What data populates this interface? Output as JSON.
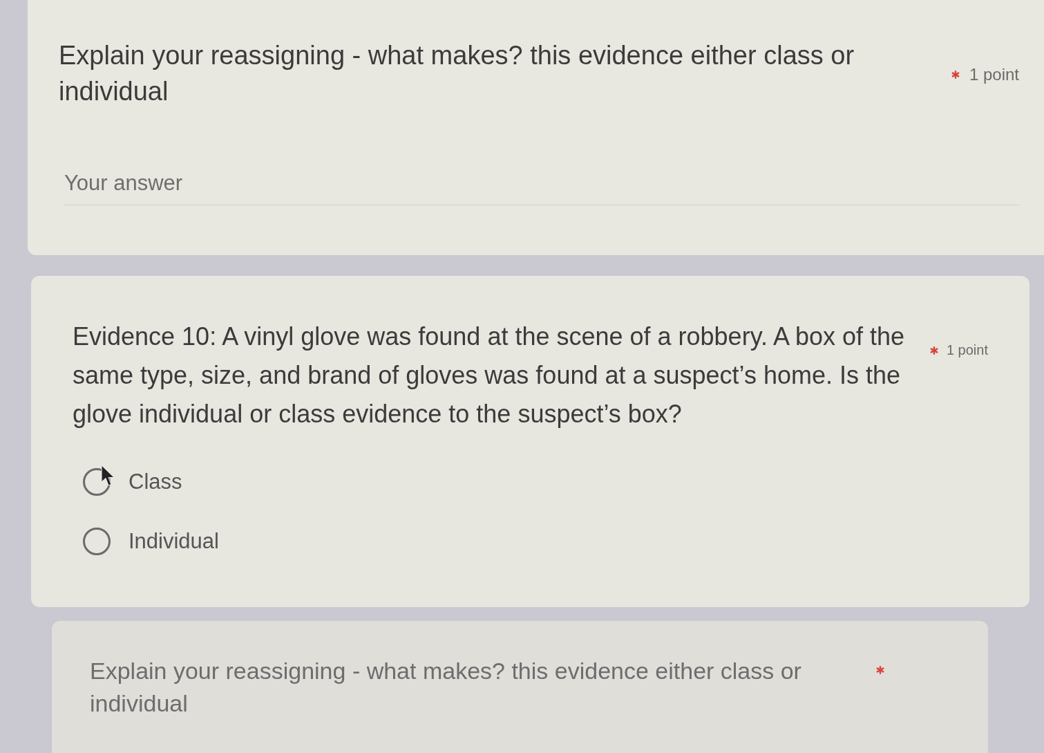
{
  "questions": [
    {
      "kind": "text",
      "title": "Explain your reassigning - what makes? this evidence either class or individual",
      "required": true,
      "points": "1 point",
      "answer": {
        "placeholder": "Your answer"
      }
    },
    {
      "kind": "choice",
      "title": "Evidence 10: A vinyl glove was found at the scene of a robbery. A box of the same type, size, and brand of gloves was found at a suspect’s home. Is the glove individual or class evidence to the suspect’s box?",
      "required": true,
      "points": "1 point",
      "options": [
        {
          "label": "Class",
          "selected": false
        },
        {
          "label": "Individual",
          "selected": false
        }
      ]
    },
    {
      "kind": "text",
      "title": "Explain your reassigning - what makes? this evidence either class or individual",
      "required": true
    }
  ]
}
